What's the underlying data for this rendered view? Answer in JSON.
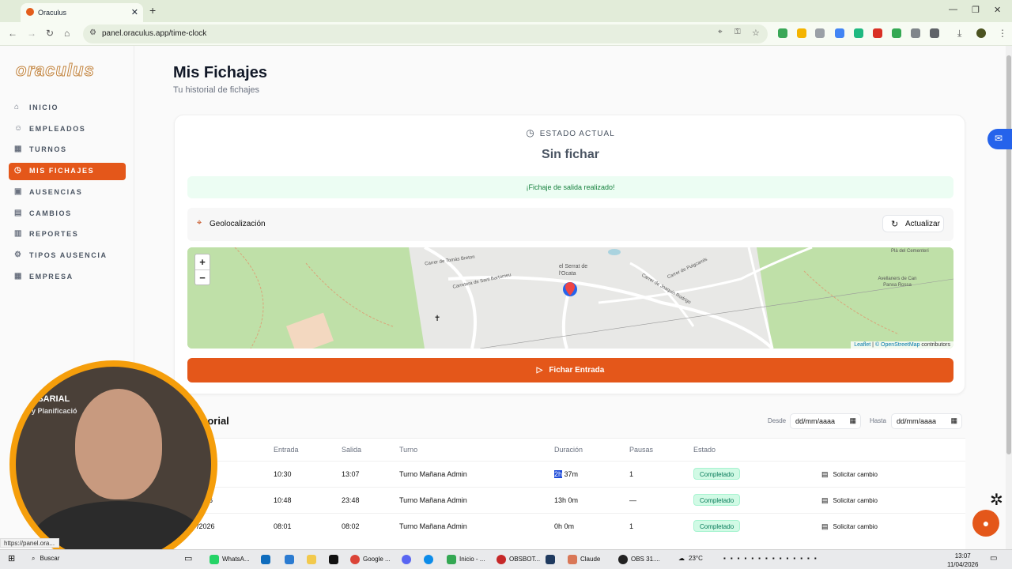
{
  "browser": {
    "tab_title": "Oraculus",
    "url": "panel.oraculus.app/time-clock",
    "status_url": "https://panel.ora..."
  },
  "sidebar": {
    "logo": "oraculus",
    "items": [
      {
        "label": "INICIO",
        "icon": "home-icon"
      },
      {
        "label": "EMPLEADOS",
        "icon": "users-icon"
      },
      {
        "label": "TURNOS",
        "icon": "calendar-icon"
      },
      {
        "label": "MIS FICHAJES",
        "icon": "clock-icon"
      },
      {
        "label": "AUSENCIAS",
        "icon": "calendar-x-icon"
      },
      {
        "label": "CAMBIOS",
        "icon": "clipboard-icon"
      },
      {
        "label": "REPORTES",
        "icon": "bar-chart-icon"
      },
      {
        "label": "TIPOS AUSENCIA",
        "icon": "gear-icon"
      },
      {
        "label": "EMPRESA",
        "icon": "building-icon"
      }
    ]
  },
  "page": {
    "title": "Mis Fichajes",
    "subtitle": "Tu historial de fichajes"
  },
  "estado": {
    "label": "ESTADO ACTUAL",
    "value": "Sin fichar",
    "alert": "¡Fichaje de salida realizado!"
  },
  "geo": {
    "label": "Geolocalización",
    "refresh": "Actualizar"
  },
  "map": {
    "labels": {
      "serrat": "el Serrat de l'Ocata",
      "tomas": "Carrer de Tomàs Breton",
      "bartomeu": "Carretera de Sant Bartomeu",
      "puigcarols": "Carrer de Puigcarols",
      "joaquin": "Carrer de Joaquin Rodrigo",
      "cementeri": "Plà del Cementeri",
      "avellaners": "Avellaners de Can Panxa Rossa"
    },
    "attribution_leaflet": "Leaflet",
    "attribution_osm": "© OpenStreetMap",
    "attribution_rest": "contributors"
  },
  "fichar_button": "Fichar Entrada",
  "historial": {
    "title": "torial",
    "desde_label": "Desde",
    "hasta_label": "Hasta",
    "date_placeholder": "dd/mm/aaaa",
    "headers": [
      "Entrada",
      "Salida",
      "Turno",
      "Duración",
      "Pausas",
      "Estado"
    ],
    "rows": [
      {
        "fecha": "",
        "entrada": "10:30",
        "salida": "13:07",
        "turno": "Turno Mañana Admin",
        "duracion_hl": "2h",
        "duracion_rest": " 37m",
        "pausas": "1",
        "estado": "Completado",
        "accion": "Solicitar cambio"
      },
      {
        "fecha": "26",
        "entrada": "10:48",
        "salida": "23:48",
        "turno": "Turno Mañana Admin",
        "duracion_hl": "",
        "duracion_rest": "13h 0m",
        "pausas": "—",
        "estado": "Completado",
        "accion": "Solicitar cambio"
      },
      {
        "fecha": "/2026",
        "entrada": "08:01",
        "salida": "08:02",
        "turno": "Turno Mañana Admin",
        "duracion_hl": "",
        "duracion_rest": "0h 0m",
        "pausas": "1",
        "estado": "Completado",
        "accion": "Solicitar cambio"
      }
    ]
  },
  "webcam": {
    "overlay_line1": "ESARIAL",
    "overlay_line2": "y Planificació"
  },
  "taskbar": {
    "search": "Buscar",
    "items": [
      "WhatsA...",
      "Google ...",
      "Inicio - ...",
      "OBSBOT...",
      "Claude",
      "OBS 31...."
    ],
    "weather": "23°C",
    "time": "13:07",
    "date": "11/04/2026"
  },
  "colors": {
    "accent": "#e4571a",
    "success_bg": "#d1fae5",
    "success_text": "#047857"
  }
}
